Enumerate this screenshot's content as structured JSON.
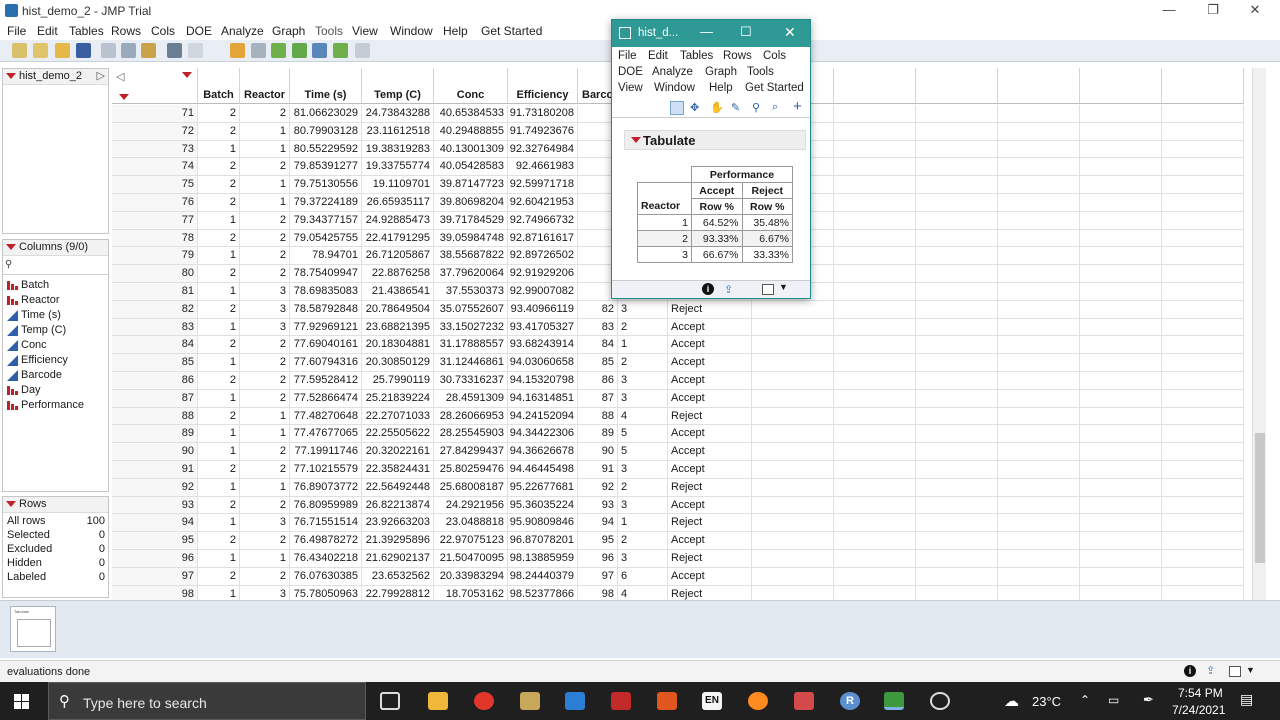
{
  "window": {
    "title": "hist_demo_2 - JMP Trial",
    "minimize": "—",
    "maximize": "❐",
    "close": "✕"
  },
  "menu": [
    "File",
    "Edit",
    "Tables",
    "Rows",
    "Cols",
    "DOE",
    "Analyze",
    "Graph",
    "Tools",
    "View",
    "Window",
    "Help",
    "Get Started"
  ],
  "table_name": "hist_demo_2",
  "columns_panel": {
    "header": "Columns (9/0)",
    "items": [
      {
        "name": "Batch",
        "type": "nominal"
      },
      {
        "name": "Reactor",
        "type": "nominal"
      },
      {
        "name": "Time (s)",
        "type": "continuous"
      },
      {
        "name": "Temp (C)",
        "type": "continuous"
      },
      {
        "name": "Conc",
        "type": "continuous"
      },
      {
        "name": "Efficiency",
        "type": "continuous"
      },
      {
        "name": "Barcode",
        "type": "continuous"
      },
      {
        "name": "Day",
        "type": "nominal"
      },
      {
        "name": "Performance",
        "type": "nominal"
      }
    ]
  },
  "rows_panel": {
    "header": "Rows",
    "items": [
      {
        "label": "All rows",
        "value": "100"
      },
      {
        "label": "Selected",
        "value": "0"
      },
      {
        "label": "Excluded",
        "value": "0"
      },
      {
        "label": "Hidden",
        "value": "0"
      },
      {
        "label": "Labeled",
        "value": "0"
      }
    ]
  },
  "grid": {
    "headers": [
      "Batch",
      "Reactor",
      "Time (s)",
      "Temp (C)",
      "Conc",
      "Efficiency",
      "Barco"
    ],
    "rows": [
      [
        "71",
        "2",
        "2",
        "81.06623029",
        "24.73843288",
        "40.65384533",
        "91.73180208",
        "",
        "",
        ""
      ],
      [
        "72",
        "2",
        "1",
        "80.79903128",
        "23.11612518",
        "40.29488855",
        "91.74923676",
        "",
        "",
        ""
      ],
      [
        "73",
        "1",
        "1",
        "80.55229592",
        "19.38319283",
        "40.13001309",
        "92.32764984",
        "",
        "",
        ""
      ],
      [
        "74",
        "2",
        "2",
        "79.85391277",
        "19.33755774",
        "40.05428583",
        "92.4661983",
        "",
        "",
        ""
      ],
      [
        "75",
        "2",
        "1",
        "79.75130556",
        "19.1109701",
        "39.87147723",
        "92.59971718",
        "",
        "",
        ""
      ],
      [
        "76",
        "2",
        "1",
        "79.37224189",
        "26.65935117",
        "39.80698204",
        "92.60421953",
        "",
        "",
        ""
      ],
      [
        "77",
        "1",
        "2",
        "79.34377157",
        "24.92885473",
        "39.71784529",
        "92.74966732",
        "",
        "",
        ""
      ],
      [
        "78",
        "2",
        "2",
        "79.05425755",
        "22.41791295",
        "39.05984748",
        "92.87161617",
        "",
        "",
        ""
      ],
      [
        "79",
        "1",
        "2",
        "78.94701",
        "26.71205867",
        "38.55687822",
        "92.89726502",
        "",
        "",
        ""
      ],
      [
        "80",
        "2",
        "2",
        "78.75409947",
        "22.8876258",
        "37.79620064",
        "92.91929206",
        "",
        "",
        ""
      ],
      [
        "81",
        "1",
        "3",
        "78.69835083",
        "21.4386541",
        "37.5530373",
        "92.99007082",
        "",
        "",
        ""
      ],
      [
        "82",
        "2",
        "3",
        "78.58792848",
        "20.78649504",
        "35.07552607",
        "93.40966119",
        "82",
        "3",
        "Reject"
      ],
      [
        "83",
        "1",
        "3",
        "77.92969121",
        "23.68821395",
        "33.15027232",
        "93.41705327",
        "83",
        "2",
        "Accept"
      ],
      [
        "84",
        "2",
        "2",
        "77.69040161",
        "20.18304881",
        "31.17888557",
        "93.68243914",
        "84",
        "1",
        "Accept"
      ],
      [
        "85",
        "1",
        "2",
        "77.60794316",
        "20.30850129",
        "31.12446861",
        "94.03060658",
        "85",
        "2",
        "Accept"
      ],
      [
        "86",
        "2",
        "2",
        "77.59528412",
        "25.7990119",
        "30.73316237",
        "94.15320798",
        "86",
        "3",
        "Accept"
      ],
      [
        "87",
        "1",
        "2",
        "77.52866474",
        "25.21839224",
        "28.4591309",
        "94.16314851",
        "87",
        "3",
        "Accept"
      ],
      [
        "88",
        "2",
        "1",
        "77.48270648",
        "22.27071033",
        "28.26066953",
        "94.24152094",
        "88",
        "4",
        "Reject"
      ],
      [
        "89",
        "1",
        "1",
        "77.47677065",
        "22.25505622",
        "28.25545903",
        "94.34422306",
        "89",
        "5",
        "Accept"
      ],
      [
        "90",
        "1",
        "2",
        "77.19911746",
        "20.32022161",
        "27.84299437",
        "94.36626678",
        "90",
        "5",
        "Accept"
      ],
      [
        "91",
        "2",
        "2",
        "77.10215579",
        "22.35824431",
        "25.80259476",
        "94.46445498",
        "91",
        "3",
        "Accept"
      ],
      [
        "92",
        "1",
        "1",
        "76.89073772",
        "22.56492448",
        "25.68008187",
        "95.22677681",
        "92",
        "2",
        "Reject"
      ],
      [
        "93",
        "2",
        "2",
        "76.80959989",
        "26.82213874",
        "24.2921956",
        "95.36035224",
        "93",
        "3",
        "Accept"
      ],
      [
        "94",
        "1",
        "3",
        "76.71551514",
        "23.92663203",
        "23.0488818",
        "95.90809846",
        "94",
        "1",
        "Reject"
      ],
      [
        "95",
        "2",
        "2",
        "76.49878272",
        "21.39295896",
        "22.97075123",
        "96.87078201",
        "95",
        "2",
        "Accept"
      ],
      [
        "96",
        "1",
        "1",
        "76.43402218",
        "21.62902137",
        "21.50470095",
        "98.13885959",
        "96",
        "3",
        "Reject"
      ],
      [
        "97",
        "2",
        "2",
        "76.07630385",
        "23.6532562",
        "20.33983294",
        "98.24440379",
        "97",
        "6",
        "Accept"
      ],
      [
        "98",
        "1",
        "3",
        "75.78050963",
        "22.79928812",
        "18.7053162",
        "98.52377866",
        "98",
        "4",
        "Reject"
      ]
    ]
  },
  "float": {
    "title": "hist_d...",
    "menu_row1": [
      "File",
      "Edit",
      "Tables",
      "Rows",
      "Cols"
    ],
    "menu_row2": [
      "DOE",
      "Analyze",
      "Graph",
      "Tools"
    ],
    "menu_row3": [
      "View",
      "Window",
      "Help",
      "Get Started"
    ],
    "section": "Tabulate",
    "table": {
      "group": "Performance",
      "cols": [
        "Accept",
        "Reject"
      ],
      "row_label": "Reactor",
      "stat": "Row %",
      "rows": [
        {
          "level": "1",
          "accept": "64.52%",
          "reject": "35.48%"
        },
        {
          "level": "2",
          "accept": "93.33%",
          "reject": "6.67%"
        },
        {
          "level": "3",
          "accept": "66.67%",
          "reject": "33.33%"
        }
      ]
    }
  },
  "thumbnail_label": "Tabulate",
  "status": "evaluations done",
  "taskbar": {
    "search_placeholder": "Type here to search",
    "temp": "23°C",
    "time": "7:54 PM",
    "date": "7/24/2021",
    "app_en": "EN",
    "app_r": "R"
  }
}
